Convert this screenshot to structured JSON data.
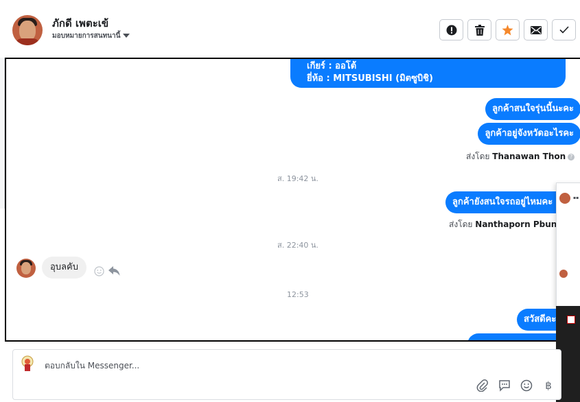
{
  "header": {
    "customer_name": "ภักดี เพตะเข้",
    "assign_label": "มอบหมายการสนทนานี้"
  },
  "actions": {
    "spam_icon": "exclamation-icon",
    "delete_icon": "trash-icon",
    "star_icon": "star-icon",
    "unread_icon": "envelope-icon",
    "done_icon": "check-icon",
    "star_color": "#f5882b"
  },
  "messages": {
    "car_gear": "เกียร์ : ออโต้",
    "car_brand": "ยี่ห้อ : MITSUBISHI (มิตซูบิชิ)",
    "msg1": "ลูกค้าสนใจรุ่นนี้นะคะ",
    "msg2": "ลูกค้าอยู่จังหวัดอะไรคะ",
    "sent_by_label1": "ส่งโดย",
    "sent_by_name1": "Thanawan Thon",
    "time1": "ส. 19:42 น.",
    "msg3": "ลูกค้ายังสนใจรถอยู่ไหมคะ",
    "sent_by_label2": "ส่งโดย",
    "sent_by_name2": "Nanthaporn Pbunny",
    "time2": "ส. 22:40 น.",
    "incoming1": "อุบลคับ",
    "time3": "12:53",
    "msg4": "สวัสดีคะ"
  },
  "composer": {
    "placeholder": "ตอบกลับใน Messenger...",
    "currency_icon": "฿"
  },
  "colors": {
    "bubble_out": "#0a7cff",
    "bubble_in": "#f0f0f0"
  }
}
